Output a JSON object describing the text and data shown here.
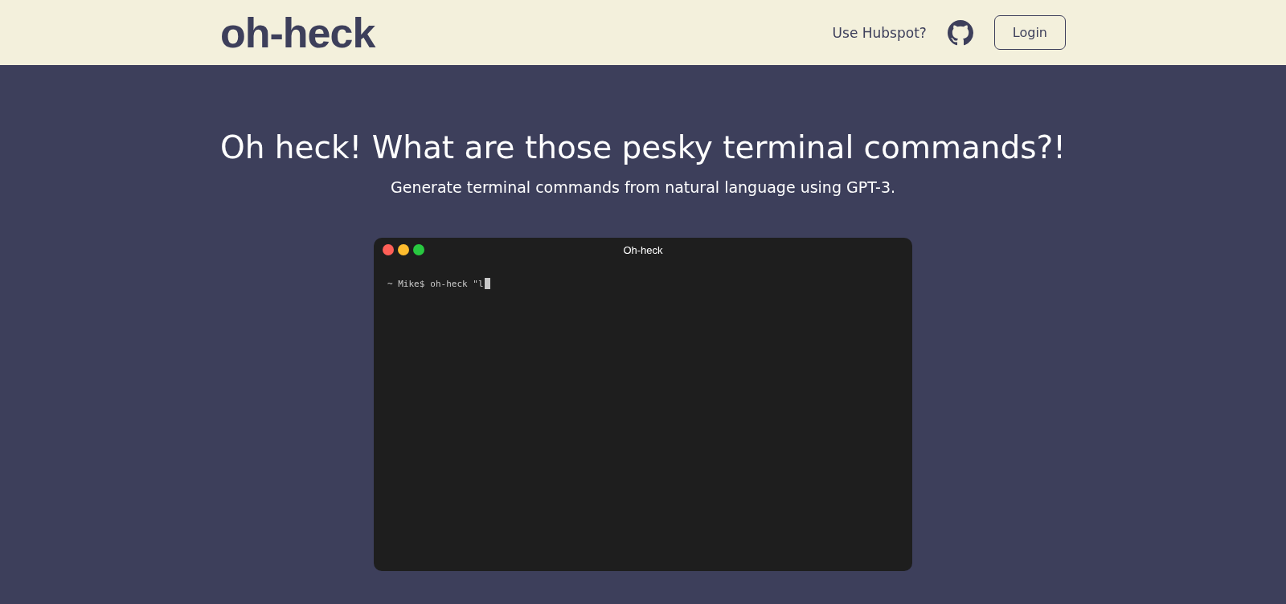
{
  "header": {
    "logo": "oh-heck",
    "nav_link": "Use Hubspot?",
    "login_button": "Login"
  },
  "hero": {
    "title": "Oh heck! What are those pesky terminal commands?!",
    "subtitle": "Generate terminal commands from natural language using GPT-3."
  },
  "terminal": {
    "title": "Oh-heck",
    "window_buttons": [
      {
        "color": "#fe5f57"
      },
      {
        "color": "#febc2e"
      },
      {
        "color": "#28c840"
      }
    ],
    "prompt": "~ Mike$",
    "command": "oh-heck \"l"
  }
}
